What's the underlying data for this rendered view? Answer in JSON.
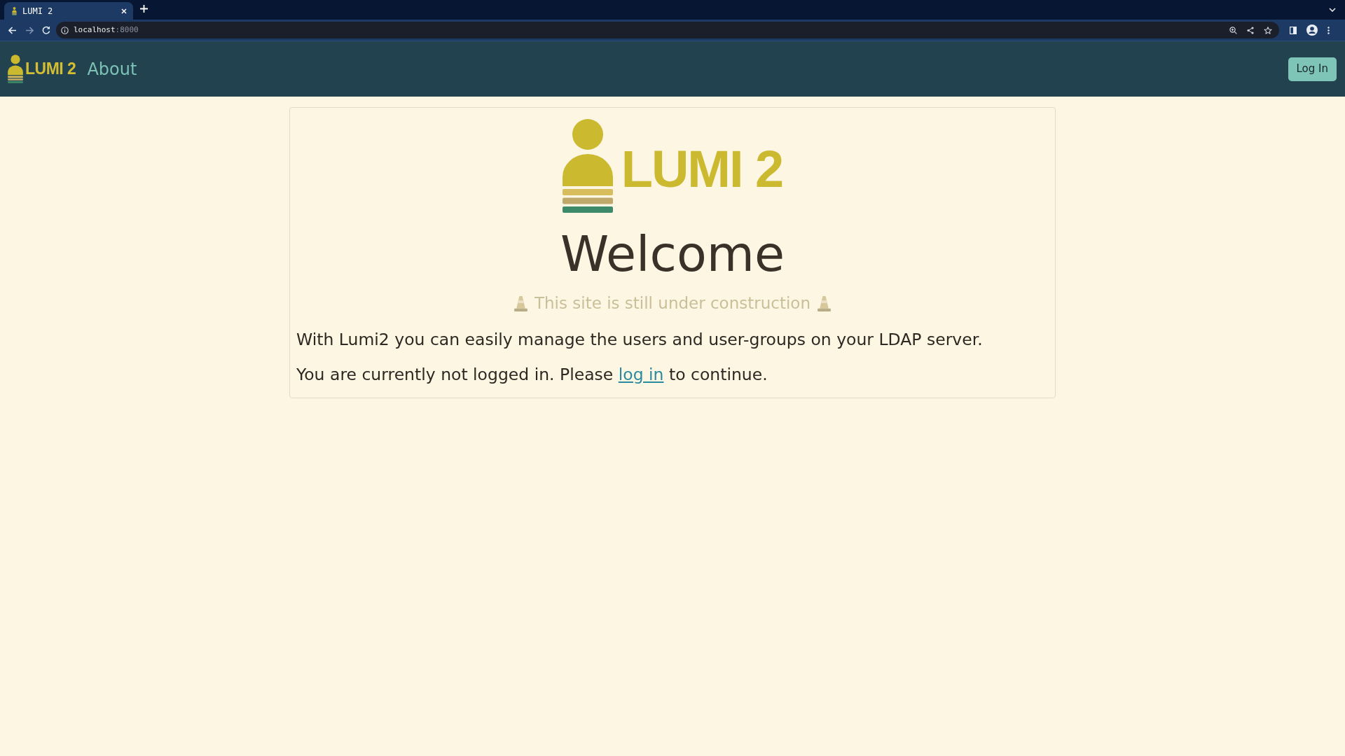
{
  "browser": {
    "tabs": [
      {
        "title": "LUMI 2",
        "selected": true
      }
    ],
    "address": {
      "host": "localhost",
      "port": ":8000"
    }
  },
  "navbar": {
    "brand": "LUMI 2",
    "links": [
      {
        "label": "About"
      }
    ],
    "login_button": "Log In"
  },
  "card": {
    "logo_text": "LUMI 2",
    "heading": "Welcome",
    "notice": "This site is still under construction",
    "paragraphs": [
      {
        "parts": [
          {
            "kind": "text",
            "text": "With Lumi2 you can easily manage the users and user-groups on your LDAP server."
          }
        ]
      },
      {
        "parts": [
          {
            "kind": "text",
            "text": "You are currently not logged in. Please "
          },
          {
            "kind": "link",
            "text": "log in"
          },
          {
            "kind": "text",
            "text": " to continue."
          }
        ]
      }
    ]
  }
}
